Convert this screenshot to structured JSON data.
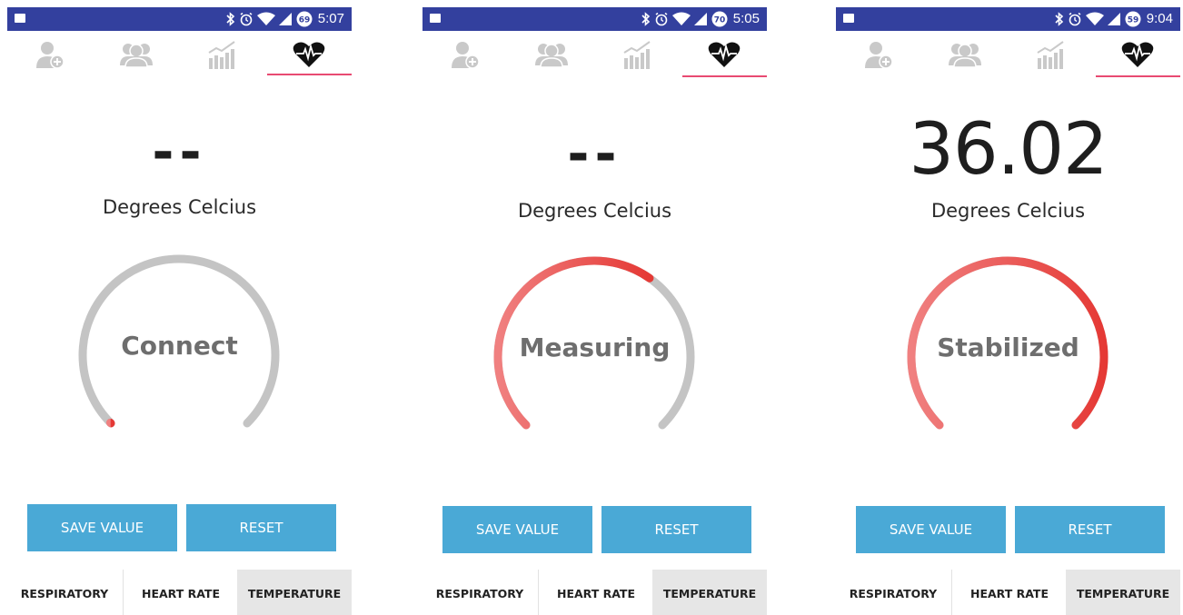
{
  "theme": {
    "statusbar_color": "#33409e",
    "accent_underline": "#e84a72",
    "button_color": "#4aa9d6",
    "gauge_track": "#c4c4c4",
    "gauge_progress_start": "#f08080",
    "gauge_progress_end": "#e53935",
    "selected_tab_bg": "#e6e6e6"
  },
  "top_tabs": [
    {
      "icon": "add-user-icon",
      "selected": false
    },
    {
      "icon": "group-icon",
      "selected": false
    },
    {
      "icon": "bar-chart-icon",
      "selected": false
    },
    {
      "icon": "heart-pulse-icon",
      "selected": true
    }
  ],
  "screens": [
    {
      "status": {
        "time": "5:07",
        "battery": "69"
      },
      "reading": "--",
      "unit": "Degrees Celcius",
      "gauge": {
        "label": "Connect",
        "progress": 0.0
      },
      "buttons": {
        "save": "SAVE VALUE",
        "reset": "RESET"
      },
      "bottom_nav": {
        "items": [
          "RESPIRATORY",
          "HEART RATE",
          "TEMPERATURE"
        ],
        "selected": "TEMPERATURE"
      }
    },
    {
      "status": {
        "time": "5:05",
        "battery": "70"
      },
      "reading": "--",
      "unit": "Degrees Celcius",
      "gauge": {
        "label": "Measuring",
        "progress": 0.63
      },
      "buttons": {
        "save": "SAVE VALUE",
        "reset": "RESET"
      },
      "bottom_nav": {
        "items": [
          "RESPIRATORY",
          "HEART RATE",
          "TEMPERATURE"
        ],
        "selected": "TEMPERATURE"
      }
    },
    {
      "status": {
        "time": "9:04",
        "battery": "59"
      },
      "reading": "36.02",
      "unit": "Degrees Celcius",
      "gauge": {
        "label": "Stabilized",
        "progress": 1.0
      },
      "buttons": {
        "save": "SAVE VALUE",
        "reset": "RESET"
      },
      "bottom_nav": {
        "items": [
          "RESPIRATORY",
          "HEART RATE",
          "TEMPERATURE"
        ],
        "selected": "TEMPERATURE"
      }
    }
  ]
}
